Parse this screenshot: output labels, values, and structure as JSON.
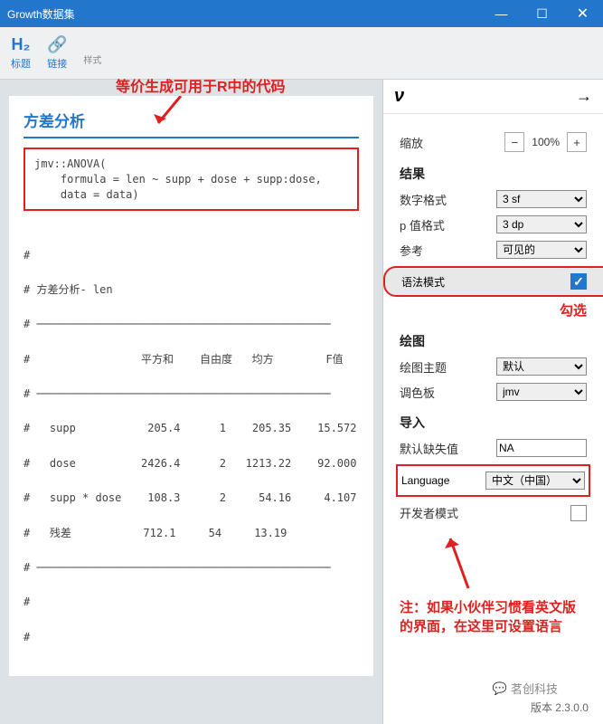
{
  "window": {
    "title": "Growth数据集"
  },
  "toolbar": {
    "heading": {
      "icon": "H₂",
      "label": "标题"
    },
    "link": {
      "icon": "🔗",
      "label": "链接"
    },
    "small": "样式"
  },
  "sheet": {
    "title": "方差分析",
    "code": "jmv::ANOVA(\n    formula = len ~ supp + dose + supp:dose,\n    data = data)",
    "table_title": " 方差分析- len",
    "headers": "                 平方和    自由度   均方        F值",
    "rows": [
      "   supp           205.4      1    205.35    15.572",
      "   dose          2426.4      2   1213.22    92.000",
      "   supp * dose    108.3      2     54.16     4.107",
      "   残差           712.1     54     13.19"
    ]
  },
  "panel": {
    "zoom": {
      "label": "缩放",
      "value": "100%"
    },
    "results": "结果",
    "numfmt": {
      "label": "数字格式",
      "value": "3 sf"
    },
    "pfmt": {
      "label": "p 值格式",
      "value": "3 dp"
    },
    "refs": {
      "label": "参考",
      "value": "可见的"
    },
    "syntax": {
      "label": "语法模式"
    },
    "plots": "绘图",
    "theme": {
      "label": "绘图主题",
      "value": "默认"
    },
    "palette": {
      "label": "调色板",
      "value": "jmv"
    },
    "import": "导入",
    "missing": {
      "label": "默认缺失值",
      "value": "NA"
    },
    "lang": {
      "label": "Language",
      "value": "中文（中国）"
    },
    "dev": {
      "label": "开发者模式"
    }
  },
  "annots": {
    "a1": "等价生成可用于R中的代码",
    "a2": "勾选",
    "a3": "注：如果小伙伴习惯看英文版的界面，在这里可设置语言"
  },
  "footer": {
    "brand": "茗创科技",
    "version": "版本 2.3.0.0"
  }
}
